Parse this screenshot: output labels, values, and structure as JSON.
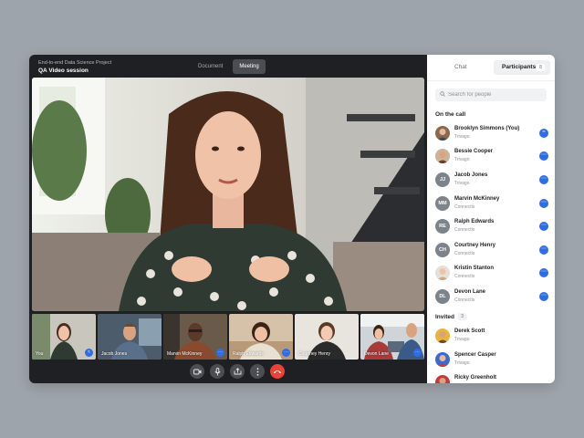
{
  "header": {
    "project": "End-to-end Data Science Project",
    "session": "QA Video session",
    "tabs": [
      "Document",
      "Meeting"
    ],
    "active_tab": "Meeting"
  },
  "thumbnails": [
    {
      "name": "You"
    },
    {
      "name": "Jacob Jones"
    },
    {
      "name": "Marvin McKinney"
    },
    {
      "name": "Ralph Edwards"
    },
    {
      "name": "Courtney Henry"
    },
    {
      "name": "Devon Lane"
    }
  ],
  "controls": [
    "video-camera-icon",
    "microphone-icon",
    "share-screen-icon",
    "more-icon",
    "end-call-icon"
  ],
  "sidebar": {
    "tab_chat": "Chat",
    "tab_participants": "Participants",
    "participants_count": "8",
    "search_placeholder": "Search for people",
    "on_call_title": "On the call",
    "invited_title": "Invited",
    "invited_count": "3",
    "on_call": [
      {
        "name": "Brooklyn Simmons (You)",
        "org": "Trivago",
        "initials": ""
      },
      {
        "name": "Bessie Cooper",
        "org": "Trivago",
        "initials": ""
      },
      {
        "name": "Jacob Jones",
        "org": "Trivago",
        "initials": "JJ"
      },
      {
        "name": "Marvin McKinney",
        "org": "Connectis",
        "initials": "MM"
      },
      {
        "name": "Ralph Edwards",
        "org": "Connectis",
        "initials": "RE"
      },
      {
        "name": "Courtney Henry",
        "org": "Connectis",
        "initials": "CH"
      },
      {
        "name": "Kristin Stanton",
        "org": "Connectis",
        "initials": ""
      },
      {
        "name": "Devon Lane",
        "org": "Connectis",
        "initials": "DL"
      }
    ],
    "invited": [
      {
        "name": "Derek Scott",
        "org": "Trivago"
      },
      {
        "name": "Spencer Casper",
        "org": "Trivago"
      },
      {
        "name": "Ricky Greenholt",
        "org": ""
      }
    ]
  },
  "colors": {
    "accent": "#2f6de6",
    "end_call": "#ea4335",
    "meeting_bg": "#1e2023",
    "page_bg": "#9ea4ab"
  }
}
